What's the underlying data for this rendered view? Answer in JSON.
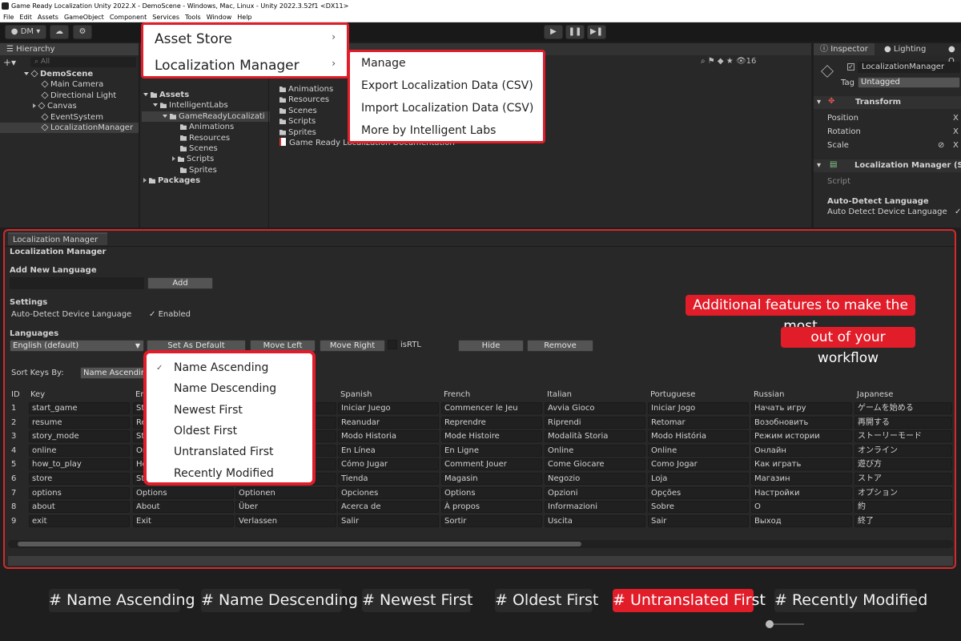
{
  "window": {
    "title": "Game Ready Localization Unity 2022.X - DemoScene - Windows, Mac, Linux - Unity 2022.3.52f1 <DX11>"
  },
  "menu": [
    "File",
    "Edit",
    "Assets",
    "GameObject",
    "Component",
    "Services",
    "Tools",
    "Window",
    "Help"
  ],
  "toolbar": {
    "account": "DM",
    "account_icon": "account-dropdown",
    "cloud_icon": "cloud-icon",
    "settings_icon": "gear-icon",
    "layer_count": "16"
  },
  "hierarchy": {
    "tab": "Hierarchy",
    "search_placeholder": "All",
    "scene": "DemoScene",
    "items": [
      "Main Camera",
      "Directional Light",
      "Canvas",
      "EventSystem",
      "LocalizationManager"
    ]
  },
  "project": {
    "assets": "Assets",
    "intelligentlabs": "IntelligentLabs",
    "gameready": "GameReadyLocalizati",
    "folders": [
      "Animations",
      "Resources",
      "Scenes",
      "Scripts",
      "Sprites"
    ],
    "packages": "Packages",
    "right_items": [
      "Animations",
      "Resources",
      "Scenes",
      "Scripts",
      "Sprites"
    ],
    "doc": "Game Ready Localization Documentation"
  },
  "context_menu": {
    "items": [
      "Asset Store",
      "Localization Manager"
    ],
    "submenu": [
      "Manage",
      "Export Localization Data (CSV)",
      "Import Localization Data (CSV)",
      "More by Intelligent Labs"
    ]
  },
  "inspector": {
    "tabs": [
      "Inspector",
      "Lighting",
      "O"
    ],
    "object_name": "LocalizationManager",
    "tag_label": "Tag",
    "tag_value": "Untagged",
    "transform": "Transform",
    "position": "Position",
    "rotation": "Rotation",
    "scale": "Scale",
    "axis_x": "X",
    "component": "Localization Manager (Scri",
    "script_label": "Script",
    "auto_detect_header": "Auto-Detect Language",
    "auto_detect_field": "Auto Detect Device Language"
  },
  "lm": {
    "tab": "Localization Manager",
    "header": "Localization Manager",
    "add_new_language": "Add New Language",
    "add_button": "Add",
    "settings": "Settings",
    "auto_detect_label": "Auto-Detect Device Language",
    "enabled": "Enabled",
    "languages": "Languages",
    "language_selected": "English (default)",
    "set_default": "Set As Default",
    "move_left": "Move Left",
    "move_right": "Move Right",
    "is_rtl": "isRTL",
    "hide": "Hide",
    "remove": "Remove",
    "sort_label": "Sort Keys By:",
    "sort_value": "Name Ascending",
    "callout1": "Additional features to make the most",
    "callout2": "out of your workflow"
  },
  "sort_menu": {
    "checked_index": 0,
    "items": [
      "Name Ascending",
      "Name Descending",
      "Newest First",
      "Oldest First",
      "Untranslated First",
      "Recently Modified"
    ]
  },
  "table": {
    "headers": [
      "ID",
      "Key",
      "En",
      "",
      "Spanish",
      "French",
      "Italian",
      "Portuguese",
      "Russian",
      "Japanese"
    ],
    "rows": [
      {
        "id": "1",
        "key": "start_game",
        "en": "St",
        "de": "",
        "es": "Iniciar Juego",
        "fr": "Commencer le Jeu",
        "it": "Avvia Gioco",
        "pt": "Iniciar Jogo",
        "ru": "Начать игру",
        "ja": "ゲームを始める"
      },
      {
        "id": "2",
        "key": "resume",
        "en": "Re",
        "de": "",
        "es": "Reanudar",
        "fr": "Reprendre",
        "it": "Riprendi",
        "pt": "Retomar",
        "ru": "Возобновить",
        "ja": "再開する"
      },
      {
        "id": "3",
        "key": "story_mode",
        "en": "St",
        "de": "",
        "es": "Modo Historia",
        "fr": "Mode Histoire",
        "it": "Modalità Storia",
        "pt": "Modo História",
        "ru": "Режим истории",
        "ja": "ストーリーモード"
      },
      {
        "id": "4",
        "key": "online",
        "en": "Or",
        "de": "",
        "es": "En Línea",
        "fr": "En Ligne",
        "it": "Online",
        "pt": "Online",
        "ru": "Онлайн",
        "ja": "オンライン"
      },
      {
        "id": "5",
        "key": "how_to_play",
        "en": "Ho",
        "de": "",
        "es": "Cómo Jugar",
        "fr": "Comment Jouer",
        "it": "Come Giocare",
        "pt": "Como Jogar",
        "ru": "Как играть",
        "ja": "遊び方"
      },
      {
        "id": "6",
        "key": "store",
        "en": "St",
        "de": "",
        "es": "Tienda",
        "fr": "Magasin",
        "it": "Negozio",
        "pt": "Loja",
        "ru": "Магазин",
        "ja": "ストア"
      },
      {
        "id": "7",
        "key": "options",
        "en": "Options",
        "de": "Optionen",
        "es": "Opciones",
        "fr": "Options",
        "it": "Opzioni",
        "pt": "Opções",
        "ru": "Настройки",
        "ja": "オプション"
      },
      {
        "id": "8",
        "key": "about",
        "en": "About",
        "de": "Über",
        "es": "Acerca de",
        "fr": "À propos",
        "it": "Informazioni",
        "pt": "Sobre",
        "ru": "О",
        "ja": "約"
      },
      {
        "id": "9",
        "key": "exit",
        "en": "Exit",
        "de": "Verlassen",
        "es": "Salir",
        "fr": "Sortir",
        "it": "Uscita",
        "pt": "Sair",
        "ru": "Выход",
        "ja": "終了"
      }
    ]
  },
  "chips": [
    "# Name Ascending",
    "#  Name Descending",
    "#  Newest First",
    "# Oldest First",
    "# Untranslated First",
    "# Recently Modified"
  ],
  "active_chip": 4,
  "colors": {
    "accent_red": "#e11d2a",
    "dark_bg": "#1e1e1e",
    "panel": "#282828"
  }
}
